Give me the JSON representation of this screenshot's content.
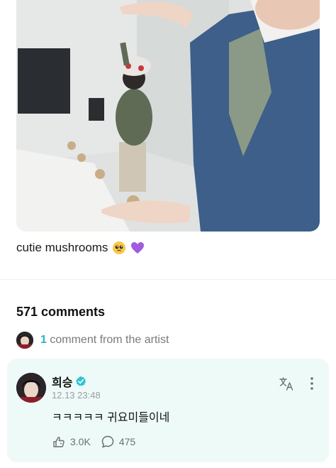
{
  "post": {
    "caption": "cutie mushrooms",
    "caption_emojis": [
      "pleading-face",
      "purple-heart"
    ]
  },
  "comments": {
    "title": "571 comments",
    "artist_count": "1",
    "artist_label": "comment from the artist"
  },
  "comment": {
    "author": "희승",
    "timestamp": "12.13 23:48",
    "text": "ㅋㅋㅋㅋㅋ 귀요미들이네",
    "likes": "3.0K",
    "replies": "475",
    "icons": {
      "verified": "verified-badge-icon",
      "translate": "translate-icon",
      "more": "more-vertical-icon",
      "like": "like-icon",
      "reply": "reply-icon"
    }
  },
  "colors": {
    "accent": "#29b3c9",
    "card_bg": "#eefaf8",
    "verified": "#2cc3d6"
  }
}
